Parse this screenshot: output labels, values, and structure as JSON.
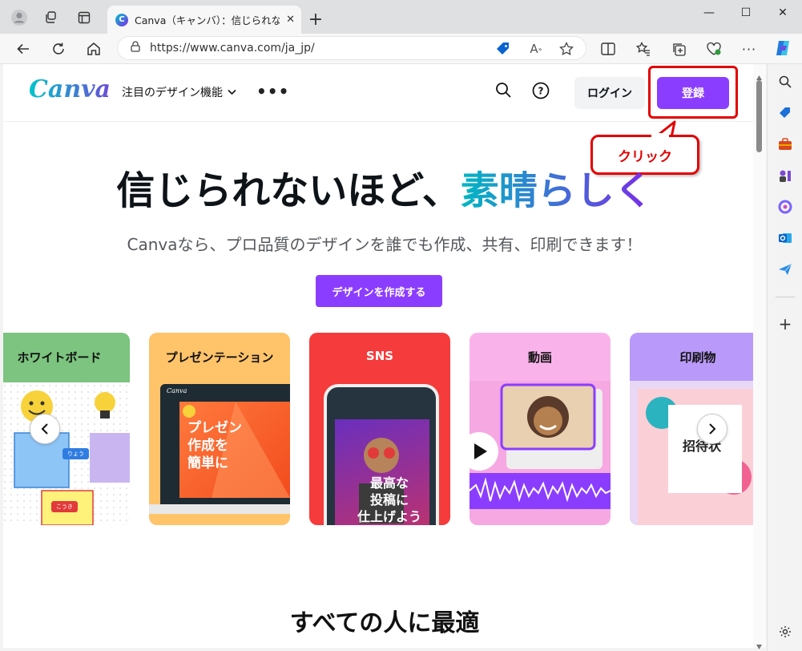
{
  "browser": {
    "tab_title": "Canva（キャンバ）：信じられないほ",
    "tab_favicon": "C",
    "new_tab": "+",
    "url": "https://www.canva.com/ja_jp/"
  },
  "window_controls": {
    "minimize": "—",
    "maximize": "☐",
    "close": "✕"
  },
  "site": {
    "logo": "Canva",
    "nav_features": "注目のデザイン機能",
    "more": "•••",
    "login": "ログイン",
    "signup": "登録",
    "callout": "クリック",
    "headline_plain": "信じられないほど、",
    "headline_accent": "素晴らしく",
    "subline": "Canvaなら、プロ品質のデザインを誰でも作成、共有、印刷できます！",
    "cta": "デザインを作成する",
    "section2_title": "すべての人に最適"
  },
  "cards": [
    {
      "title": "ホワイトボード",
      "bg": "#7cc47f",
      "sticky_1": "りょう",
      "sticky_2": "こうき"
    },
    {
      "title": "プレゼンテーション",
      "bg": "#ffc36a",
      "logo": "Canva",
      "art_text": "プレゼン\n作成を\n簡単に"
    },
    {
      "title": "SNS",
      "bg": "#f53b3b",
      "art_text": "最高な\n投稿に\n仕上げよう"
    },
    {
      "title": "動画",
      "bg": "#f9b3ea"
    },
    {
      "title": "印刷物",
      "bg": "#b99afa",
      "art_text": "招待状"
    }
  ],
  "colors": {
    "brand_purple": "#8b3dff",
    "annotation_red": "#e30000"
  }
}
